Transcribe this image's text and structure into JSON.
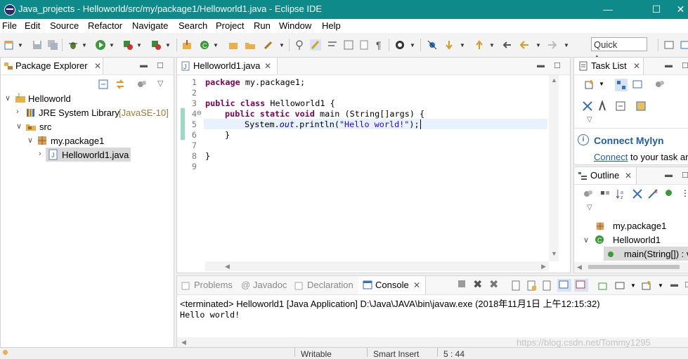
{
  "window": {
    "title": "Java_projects - Helloworld/src/my/package1/Helloworld1.java - Eclipse IDE",
    "minimize": "—",
    "maximize": "☐",
    "close": "✕"
  },
  "menu": [
    "File",
    "Edit",
    "Source",
    "Refactor",
    "Navigate",
    "Search",
    "Project",
    "Run",
    "Window",
    "Help"
  ],
  "quick_access": "Quick Access",
  "package_explorer": {
    "title": "Package Explorer",
    "tree": {
      "project": "Helloworld",
      "jre_name": "JRE System Library",
      "jre_version": "[JavaSE-10]",
      "src": "src",
      "package": "my.package1",
      "file": "Helloworld1.java"
    }
  },
  "editor": {
    "tab": "Helloworld1.java",
    "line_numbers": [
      "1",
      "2",
      "3",
      "4",
      "5",
      "6",
      "7",
      "8",
      "9"
    ],
    "fold_marker": "⊖",
    "code": {
      "l1_kw": "package",
      "l1_rest": " my.package1;",
      "l3_kw1": "public",
      "l3_kw2": "class",
      "l3_rest": " Helloworld1 {",
      "l4_kw1": "public",
      "l4_kw2": "static",
      "l4_kw3": "void",
      "l4_rest": " main (String[]args) {",
      "l5_pre": "System.",
      "l5_field": "out",
      "l5_mid": ".println(",
      "l5_str": "\"Hello world!\"",
      "l5_end": ");",
      "l6": "}",
      "l8": "}"
    }
  },
  "task_list": {
    "title": "Task List",
    "mylyn_title": "Connect Mylyn",
    "mylyn_link": "Connect",
    "mylyn_text": " to your task and ALM tools or create a local task."
  },
  "outline": {
    "title": "Outline",
    "package": "my.package1",
    "class": "Helloworld1",
    "method": "main(String[]) : void"
  },
  "console": {
    "tabs": {
      "problems": "Problems",
      "javadoc": "Javadoc",
      "declaration": "Declaration",
      "console": "Console"
    },
    "header": "<terminated> Helloworld1 [Java Application] D:\\Java\\JAVA\\bin\\javaw.exe (2018年11月1日 上午12:15:32)",
    "output": "Hello world!"
  },
  "status": {
    "writable": "Writable",
    "insert_mode": "Smart Insert",
    "position": "5 : 44"
  },
  "watermark": "https://blog.csdn.net/Tommy1295",
  "colors": {
    "titlebar": "#0e8a8a",
    "keyword": "#7f0055",
    "string": "#2a00ff",
    "field": "#0000c0",
    "mylyn": "#1f5fa8"
  }
}
